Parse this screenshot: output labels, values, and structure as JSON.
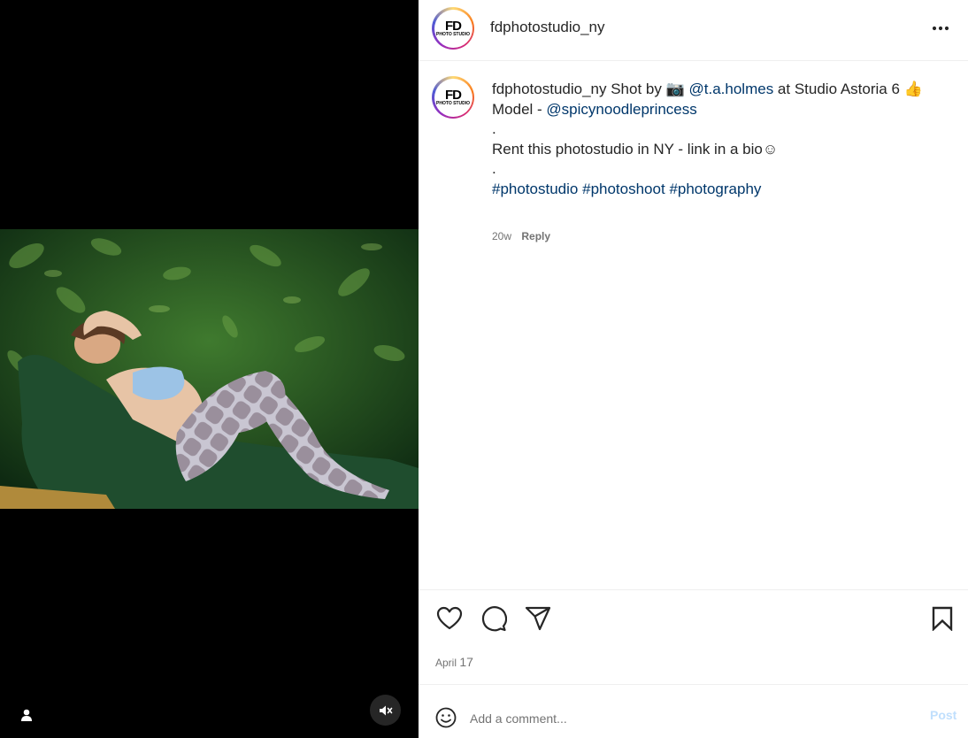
{
  "post": {
    "username": "fdphotostudio_ny",
    "avatar_logo": {
      "top": "FD",
      "bottom": "PHOTO STUDIO"
    },
    "caption": {
      "username": "fdphotostudio_ny",
      "shot_by": " Shot by ",
      "camera_emoji": "📷",
      "photographer": "@t.a.holmes",
      "location": " at Studio Astoria 6 ",
      "thumbs_emoji": "👍",
      "model_prefix": "Model - ",
      "model_handle": "@spicynoodleprincess",
      "dot1": ".",
      "rent_text": "Rent this photostudio in NY - link in a bio",
      "smile_emoji": "☺",
      "dot2": ".",
      "hashtags": [
        "#photostudio",
        "#photoshoot",
        "#photography"
      ]
    },
    "caption_meta": {
      "age": "20w",
      "reply": "Reply"
    },
    "date": {
      "month": "April",
      "day": "17"
    }
  },
  "comment_bar": {
    "placeholder": "Add a comment...",
    "post_label": "Post"
  },
  "icons": {
    "like": "heart-icon",
    "comment": "comment-icon",
    "share": "share-icon",
    "save": "bookmark-icon",
    "more": "more-icon",
    "emoji": "emoji-icon",
    "tag": "user-tag-icon",
    "mute": "muted-icon"
  },
  "colors": {
    "link": "#00376b",
    "post_disabled": "#c0dffd",
    "muted_text": "#737373"
  }
}
